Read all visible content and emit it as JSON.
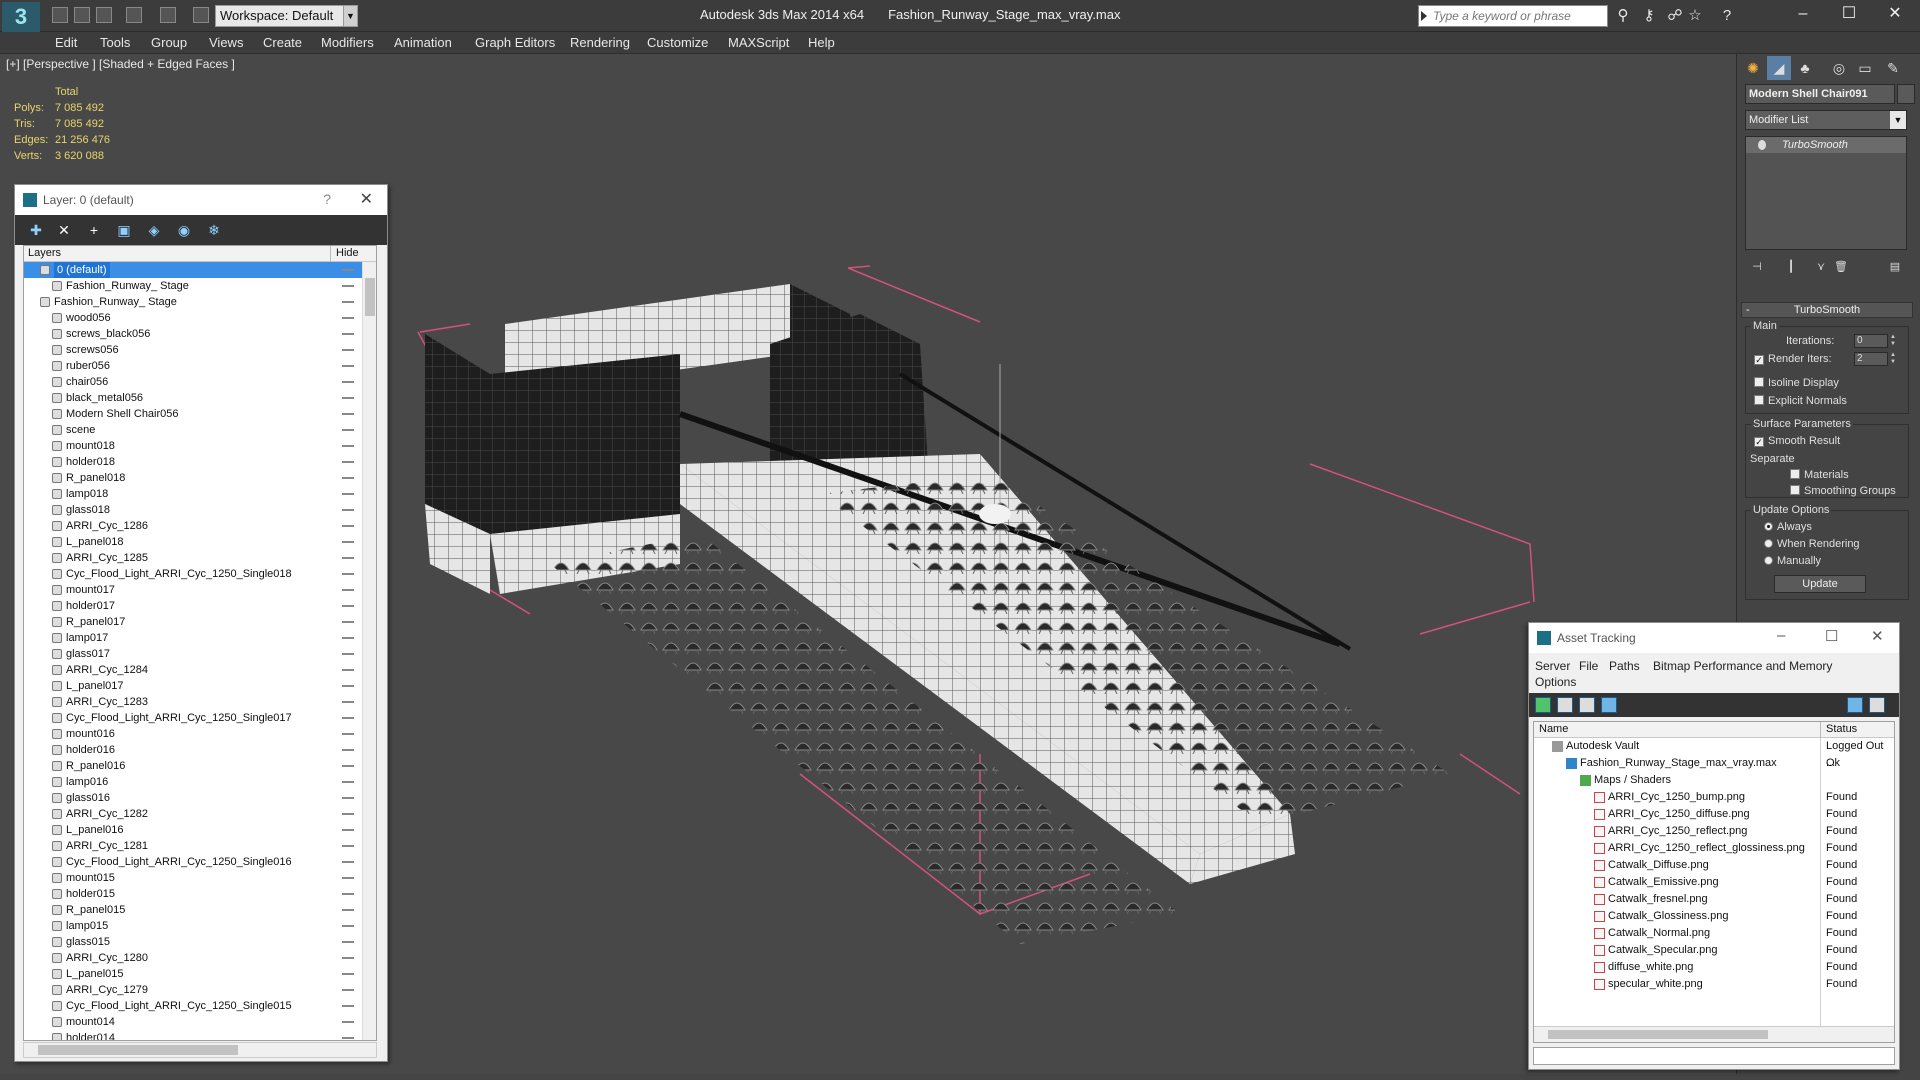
{
  "titlebar": {
    "workspace": "Workspace: Default",
    "app_title": "Autodesk 3ds Max  2014 x64",
    "file_name": "Fashion_Runway_Stage_max_vray.max",
    "search_placeholder": "Type a keyword or phrase"
  },
  "menu": [
    "Edit",
    "Tools",
    "Group",
    "Views",
    "Create",
    "Modifiers",
    "Animation",
    "Graph Editors",
    "Rendering",
    "Customize",
    "MAXScript",
    "Help"
  ],
  "viewport": {
    "label": "[+] [Perspective ] [Shaded + Edged Faces ]",
    "stats": {
      "header": "Total",
      "rows": [
        {
          "key": "Polys:",
          "value": "7 085 492"
        },
        {
          "key": "Tris:",
          "value": "7 085 492"
        },
        {
          "key": "Edges:",
          "value": "21 256 476"
        },
        {
          "key": "Verts:",
          "value": "3 620 088"
        }
      ]
    }
  },
  "layer_dialog": {
    "title": "Layer: 0 (default)",
    "help": "?",
    "col_layers": "Layers",
    "col_hide": "Hide",
    "rows": [
      {
        "label": "0 (default)",
        "depth": 0,
        "selected": true
      },
      {
        "label": "Fashion_Runway_ Stage",
        "depth": 1
      },
      {
        "label": "Fashion_Runway_ Stage",
        "depth": 0
      },
      {
        "label": "wood056",
        "depth": 1
      },
      {
        "label": "screws_black056",
        "depth": 1
      },
      {
        "label": "screws056",
        "depth": 1
      },
      {
        "label": "ruber056",
        "depth": 1
      },
      {
        "label": "chair056",
        "depth": 1
      },
      {
        "label": "black_metal056",
        "depth": 1
      },
      {
        "label": "Modern Shell Chair056",
        "depth": 1
      },
      {
        "label": "scene",
        "depth": 1
      },
      {
        "label": "mount018",
        "depth": 1
      },
      {
        "label": "holder018",
        "depth": 1
      },
      {
        "label": "R_panel018",
        "depth": 1
      },
      {
        "label": "lamp018",
        "depth": 1
      },
      {
        "label": "glass018",
        "depth": 1
      },
      {
        "label": "ARRI_Cyc_1286",
        "depth": 1
      },
      {
        "label": "L_panel018",
        "depth": 1
      },
      {
        "label": "ARRI_Cyc_1285",
        "depth": 1
      },
      {
        "label": "Cyc_Flood_Light_ARRI_Cyc_1250_Single018",
        "depth": 1
      },
      {
        "label": "mount017",
        "depth": 1
      },
      {
        "label": "holder017",
        "depth": 1
      },
      {
        "label": "R_panel017",
        "depth": 1
      },
      {
        "label": "lamp017",
        "depth": 1
      },
      {
        "label": "glass017",
        "depth": 1
      },
      {
        "label": "ARRI_Cyc_1284",
        "depth": 1
      },
      {
        "label": "L_panel017",
        "depth": 1
      },
      {
        "label": "ARRI_Cyc_1283",
        "depth": 1
      },
      {
        "label": "Cyc_Flood_Light_ARRI_Cyc_1250_Single017",
        "depth": 1
      },
      {
        "label": "mount016",
        "depth": 1
      },
      {
        "label": "holder016",
        "depth": 1
      },
      {
        "label": "R_panel016",
        "depth": 1
      },
      {
        "label": "lamp016",
        "depth": 1
      },
      {
        "label": "glass016",
        "depth": 1
      },
      {
        "label": "ARRI_Cyc_1282",
        "depth": 1
      },
      {
        "label": "L_panel016",
        "depth": 1
      },
      {
        "label": "ARRI_Cyc_1281",
        "depth": 1
      },
      {
        "label": "Cyc_Flood_Light_ARRI_Cyc_1250_Single016",
        "depth": 1
      },
      {
        "label": "mount015",
        "depth": 1
      },
      {
        "label": "holder015",
        "depth": 1
      },
      {
        "label": "R_panel015",
        "depth": 1
      },
      {
        "label": "lamp015",
        "depth": 1
      },
      {
        "label": "glass015",
        "depth": 1
      },
      {
        "label": "ARRI_Cyc_1280",
        "depth": 1
      },
      {
        "label": "L_panel015",
        "depth": 1
      },
      {
        "label": "ARRI_Cyc_1279",
        "depth": 1
      },
      {
        "label": "Cyc_Flood_Light_ARRI_Cyc_1250_Single015",
        "depth": 1
      },
      {
        "label": "mount014",
        "depth": 1
      },
      {
        "label": "holder014",
        "depth": 1
      }
    ]
  },
  "command_panel": {
    "object_name": "Modern Shell Chair091",
    "modifier_list": "Modifier List",
    "modifier_stack": [
      "TurboSmooth"
    ],
    "rollout_title": "TurboSmooth",
    "main_group": "Main",
    "iterations_label": "Iterations:",
    "iterations_value": "0",
    "render_iters_label": "Render Iters:",
    "render_iters_value": "2",
    "isoline_display": "Isoline Display",
    "explicit_normals": "Explicit Normals",
    "surface_group": "Surface Parameters",
    "smooth_result": "Smooth Result",
    "separate": "Separate",
    "materials": "Materials",
    "smoothing_groups": "Smoothing Groups",
    "update_group": "Update Options",
    "always": "Always",
    "when_rendering": "When Rendering",
    "manually": "Manually",
    "update_button": "Update"
  },
  "asset_tracking": {
    "title": "Asset Tracking",
    "menu": [
      "Server",
      "File",
      "Paths",
      "Bitmap Performance and Memory",
      "Options"
    ],
    "col_name": "Name",
    "col_status": "Status",
    "rows": [
      {
        "name": "Autodesk Vault",
        "status": "Logged Out ...",
        "depth": 0,
        "icon": "vault"
      },
      {
        "name": "Fashion_Runway_Stage_max_vray.max",
        "status": "Ok",
        "depth": 1,
        "icon": "max"
      },
      {
        "name": "Maps / Shaders",
        "status": "",
        "depth": 2,
        "icon": "folder"
      },
      {
        "name": "ARRI_Cyc_1250_bump.png",
        "status": "Found",
        "depth": 3,
        "icon": "png"
      },
      {
        "name": "ARRI_Cyc_1250_diffuse.png",
        "status": "Found",
        "depth": 3,
        "icon": "png"
      },
      {
        "name": "ARRI_Cyc_1250_reflect.png",
        "status": "Found",
        "depth": 3,
        "icon": "png"
      },
      {
        "name": "ARRI_Cyc_1250_reflect_glossiness.png",
        "status": "Found",
        "depth": 3,
        "icon": "png"
      },
      {
        "name": "Catwalk_Diffuse.png",
        "status": "Found",
        "depth": 3,
        "icon": "png"
      },
      {
        "name": "Catwalk_Emissive.png",
        "status": "Found",
        "depth": 3,
        "icon": "png"
      },
      {
        "name": "Catwalk_fresnel.png",
        "status": "Found",
        "depth": 3,
        "icon": "png"
      },
      {
        "name": "Catwalk_Glossiness.png",
        "status": "Found",
        "depth": 3,
        "icon": "png"
      },
      {
        "name": "Catwalk_Normal.png",
        "status": "Found",
        "depth": 3,
        "icon": "png"
      },
      {
        "name": "Catwalk_Specular.png",
        "status": "Found",
        "depth": 3,
        "icon": "png"
      },
      {
        "name": "diffuse_white.png",
        "status": "Found",
        "depth": 3,
        "icon": "png"
      },
      {
        "name": "specular_white.png",
        "status": "Found",
        "depth": 3,
        "icon": "png"
      }
    ]
  }
}
